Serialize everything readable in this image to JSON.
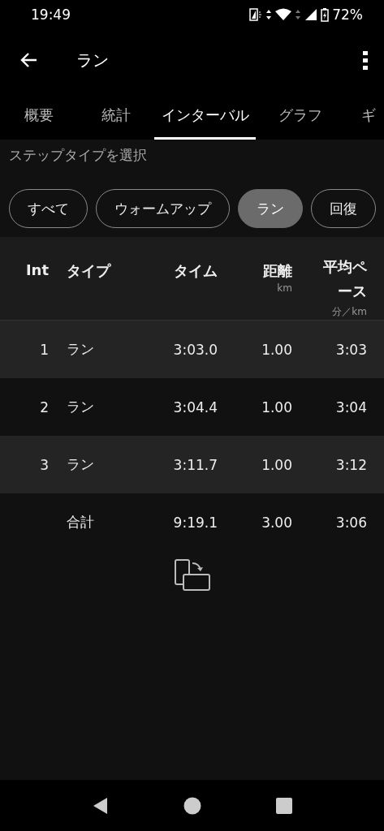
{
  "status_bar": {
    "time": "19:49",
    "battery": "72%"
  },
  "app_bar": {
    "title": "ラン"
  },
  "tabs": [
    {
      "label": "概要",
      "selected": false
    },
    {
      "label": "統計",
      "selected": false
    },
    {
      "label": "インターバル",
      "selected": true
    },
    {
      "label": "グラフ",
      "selected": false
    },
    {
      "label": "ギ",
      "selected": false
    }
  ],
  "filter": {
    "label": "ステップタイプを選択",
    "chips": [
      {
        "label": "すべて",
        "selected": false
      },
      {
        "label": "ウォームアップ",
        "selected": false
      },
      {
        "label": "ラン",
        "selected": true
      },
      {
        "label": "回復",
        "selected": false
      }
    ]
  },
  "table": {
    "columns": [
      {
        "label": "Int"
      },
      {
        "label": "タイプ"
      },
      {
        "label": "タイム"
      },
      {
        "label": "距離",
        "unit": "km"
      },
      {
        "label": "平均ペース",
        "unit": "分／km"
      }
    ],
    "rows": [
      [
        "1",
        "ラン",
        "3:03.0",
        "1.00",
        "3:03"
      ],
      [
        "2",
        "ラン",
        "3:04.4",
        "1.00",
        "3:04"
      ],
      [
        "3",
        "ラン",
        "3:11.7",
        "1.00",
        "3:12"
      ]
    ],
    "total": {
      "label": "合計",
      "values": [
        "9:19.1",
        "3.00",
        "3:06"
      ]
    }
  }
}
